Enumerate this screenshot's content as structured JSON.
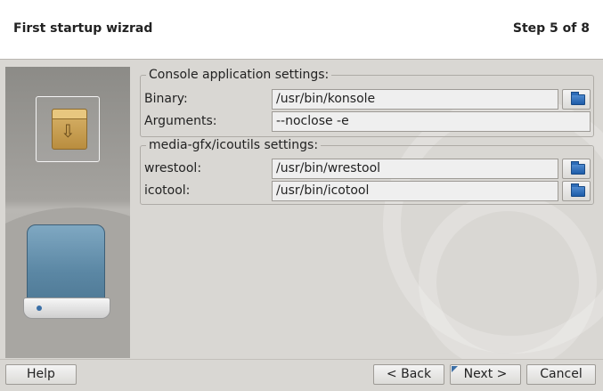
{
  "header": {
    "title": "First startup wizrad",
    "step": "Step 5 of 8"
  },
  "console_group": {
    "legend": "Console application settings:",
    "binary_label": "Binary:",
    "binary_value": "/usr/bin/konsole",
    "arguments_label": "Arguments:",
    "arguments_value": "--noclose -e"
  },
  "icoutils_group": {
    "legend": "media-gfx/icoutils settings:",
    "wrestool_label": "wrestool:",
    "wrestool_value": "/usr/bin/wrestool",
    "icotool_label": "icotool:",
    "icotool_value": "/usr/bin/icotool"
  },
  "footer": {
    "help": "Help",
    "back": "< Back",
    "next": "Next >",
    "cancel": "Cancel"
  },
  "icons": {
    "package": "package-install-icon",
    "drive": "hard-drive-icon",
    "browse": "folder-open-icon"
  },
  "colors": {
    "background": "#d9d7d3",
    "sidebar": "#a5a39f",
    "accent": "#3b6ea5"
  }
}
